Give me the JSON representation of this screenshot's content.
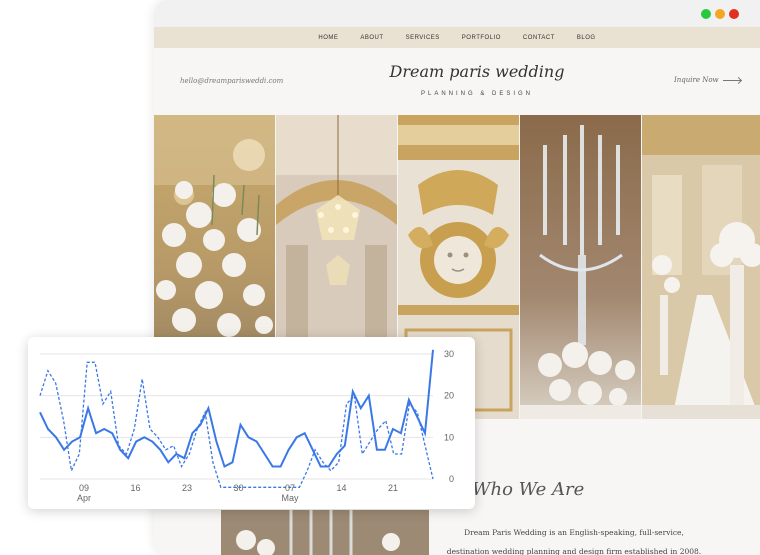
{
  "site": {
    "nav": [
      "HOME",
      "ABOUT",
      "SERVICES",
      "PORTFOLIO",
      "CONTACT",
      "BLOG"
    ],
    "email": "hello@dreamparisweddi.com",
    "logo_script": "Dream paris wedding",
    "logo_sub": "PLANNING & DESIGN",
    "inquire": "Inquire Now",
    "about_title": "Who We Are",
    "about_line1": "Dream Paris Wedding is an English-speaking, full-service,",
    "about_line2": "destination wedding planning and design firm established in 2008."
  },
  "window_controls": {
    "colors": [
      "#27c93f",
      "#f4a623",
      "#e0301e"
    ]
  },
  "chart_data": {
    "type": "line",
    "x_ticks": [
      {
        "day": "09",
        "month": "Apr"
      },
      {
        "day": "16",
        "month": ""
      },
      {
        "day": "23",
        "month": ""
      },
      {
        "day": "30",
        "month": ""
      },
      {
        "day": "07",
        "month": "May"
      },
      {
        "day": "14",
        "month": ""
      },
      {
        "day": "21",
        "month": ""
      }
    ],
    "y_ticks": [
      "30",
      "20",
      "10",
      "0"
    ],
    "ylim": [
      0,
      30
    ],
    "grid": true,
    "series": [
      {
        "style": "solid",
        "color": "#3b78e7",
        "values": [
          16,
          12,
          10,
          7,
          9,
          10,
          17,
          11,
          12,
          11,
          7,
          5,
          9,
          10,
          9,
          7,
          4,
          6,
          5,
          11,
          13,
          17,
          9,
          3,
          4,
          13,
          10,
          9,
          6,
          3,
          3,
          7,
          10,
          11,
          7,
          3,
          3,
          6,
          8,
          21,
          17,
          20,
          7,
          7,
          12,
          11,
          19,
          15,
          11,
          31
        ]
      },
      {
        "style": "dashed",
        "color": "#3b78e7",
        "values": [
          20,
          26,
          23,
          14,
          2,
          6,
          28,
          28,
          18,
          21,
          8,
          6,
          12,
          24,
          12,
          10,
          7,
          8,
          3,
          6,
          12,
          16,
          4,
          -2,
          -2,
          -2,
          -2,
          -2,
          -2,
          -2,
          -2,
          -2,
          -2,
          -2,
          2,
          7,
          4,
          2,
          4,
          18,
          20,
          6,
          9,
          12,
          14,
          6,
          6,
          18,
          16,
          8,
          0
        ]
      }
    ]
  }
}
